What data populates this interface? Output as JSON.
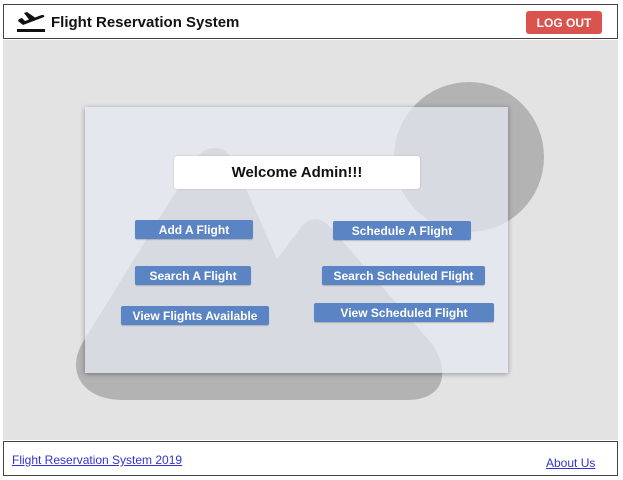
{
  "header": {
    "title": "Flight Reservation System",
    "logout_label": "LOG OUT",
    "icon": "airplane-departure-icon"
  },
  "main": {
    "welcome": "Welcome Admin!!!",
    "buttons": {
      "add_flight": "Add A Flight",
      "schedule_flight": "Schedule A Flight",
      "search_flight": "Search A Flight",
      "search_scheduled": "Search Scheduled Flight",
      "view_available": "View Flights Available",
      "view_scheduled": "View Scheduled Flight"
    }
  },
  "footer": {
    "copyright_link": "Flight Reservation System 2019",
    "about_link": "About Us"
  },
  "colors": {
    "logout": "#d9534f",
    "button": "#5b84c4",
    "background": "#e3e3e3",
    "link": "#3333cc"
  }
}
